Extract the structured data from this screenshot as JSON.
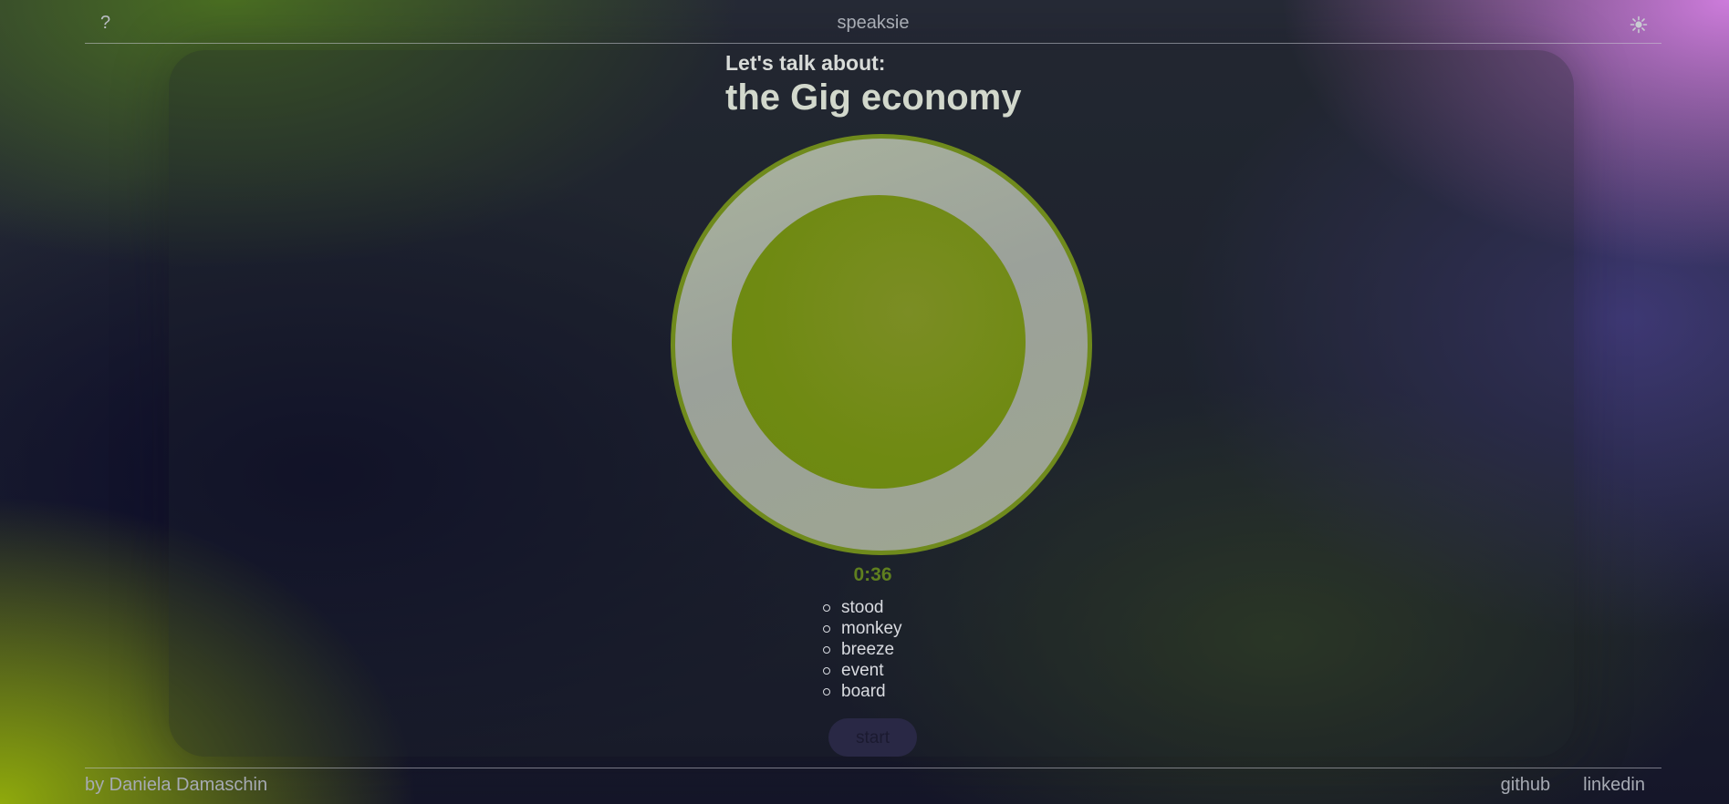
{
  "header": {
    "help_label": "?",
    "brand": "speaksie",
    "theme_icon": "sun-icon"
  },
  "prompt": {
    "lead": "Let's talk about:",
    "topic": "the Gig economy"
  },
  "timer": {
    "value": "0:36"
  },
  "words": [
    "stood",
    "monkey",
    "breeze",
    "event",
    "board"
  ],
  "actions": {
    "start_label": "start"
  },
  "footer": {
    "byline": "by Daniela Damaschin",
    "links": [
      "github",
      "linkedin"
    ]
  },
  "colors": {
    "accent": "#6f8a12",
    "ring": "#9ea690",
    "timer": "#5f7f1f"
  }
}
